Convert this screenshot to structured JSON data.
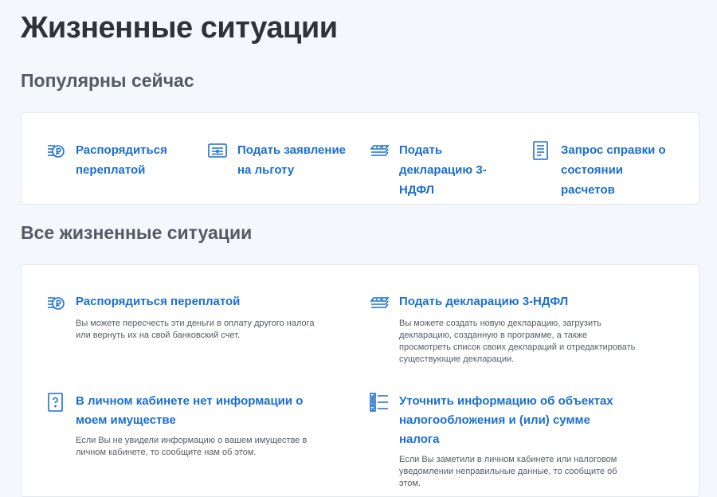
{
  "page": {
    "title": "Жизненные ситуации"
  },
  "popular": {
    "title": "Популярны сейчас",
    "items": [
      {
        "label": "Распорядиться переплатой",
        "icon": "ruble-coins-icon"
      },
      {
        "label": "Подать заявление на льготу",
        "icon": "id-card-icon"
      },
      {
        "label": "Подать декларацию 3-НДФЛ",
        "icon": "document-stack-icon"
      },
      {
        "label": "Запрос справки о состоянии расчетов",
        "icon": "document-list-icon"
      }
    ]
  },
  "all": {
    "title": "Все жизненные ситуации",
    "items": [
      {
        "title": "Распорядиться переплатой",
        "desc": "Вы можете пересчесть эти деньги в оплату другого налога или вернуть их на свой банковский счет.",
        "icon": "ruble-coins-icon"
      },
      {
        "title": "Подать декларацию 3-НДФЛ",
        "desc": "Вы можете создать новую декларацию, загрузить декларацию, созданную в программе, а также просмотреть список своих деклараций и отредактировать существующие декларации.",
        "icon": "document-stack-icon"
      },
      {
        "title": "В личном кабинете нет информации о моем имуществе",
        "desc": "Если Вы не увидели информацию о вашем имуществе в личном кабинете, то сообщите нам об этом.",
        "icon": "question-document-icon"
      },
      {
        "title": "Уточнить информацию об объектах налогообложения и (или) сумме налога",
        "desc": "Если Вы заметили в личном кабинете или налоговом уведомлении неправильные данные, то сообщите об этом.",
        "icon": "checklist-icon"
      }
    ]
  },
  "colors": {
    "accent": "#1a6fcf",
    "background": "#f4f7fb",
    "card": "#ffffff"
  }
}
